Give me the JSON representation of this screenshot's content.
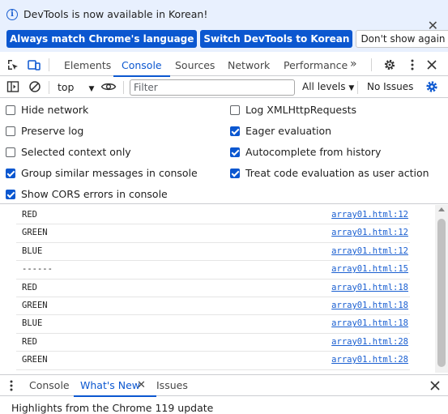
{
  "infobar": {
    "message": "DevTools is now available in Korean!",
    "btn_match": "Always match Chrome's language",
    "btn_switch": "Switch DevTools to Korean",
    "btn_dismiss": "Don't show again",
    "close_glyph": "✕"
  },
  "tabs": {
    "items": [
      "Elements",
      "Console",
      "Sources",
      "Network",
      "Performance"
    ],
    "active": "Console",
    "more_glyph": "»"
  },
  "toolbar": {
    "context": "top",
    "filter_placeholder": "Filter",
    "levels": "All levels",
    "issues": "No Issues"
  },
  "settings": {
    "left": [
      {
        "label": "Hide network",
        "checked": false
      },
      {
        "label": "Preserve log",
        "checked": false
      },
      {
        "label": "Selected context only",
        "checked": false
      },
      {
        "label": "Group similar messages in console",
        "checked": true
      },
      {
        "label": "Show CORS errors in console",
        "checked": true
      }
    ],
    "right": [
      {
        "label": "Log XMLHttpRequests",
        "checked": false
      },
      {
        "label": "Eager evaluation",
        "checked": true
      },
      {
        "label": "Autocomplete from history",
        "checked": true
      },
      {
        "label": "Treat code evaluation as user action",
        "checked": true
      }
    ]
  },
  "messages": [
    {
      "text": "RED",
      "source": "array01.html:12"
    },
    {
      "text": "GREEN",
      "source": "array01.html:12"
    },
    {
      "text": "BLUE",
      "source": "array01.html:12"
    },
    {
      "text": "------",
      "source": "array01.html:15"
    },
    {
      "text": "RED",
      "source": "array01.html:18"
    },
    {
      "text": "GREEN",
      "source": "array01.html:18"
    },
    {
      "text": "BLUE",
      "source": "array01.html:18"
    },
    {
      "text": "RED",
      "source": "array01.html:28"
    },
    {
      "text": "GREEN",
      "source": "array01.html:28"
    }
  ],
  "drawer": {
    "tabs": [
      "Console",
      "What's New",
      "Issues"
    ],
    "active": "What's New",
    "content": "Highlights from the Chrome 119 update",
    "close_glyph": "✕"
  },
  "colors": {
    "accent": "#0b57d0",
    "infobar_bg": "#e8f0fe",
    "link": "#1a5fd1"
  }
}
